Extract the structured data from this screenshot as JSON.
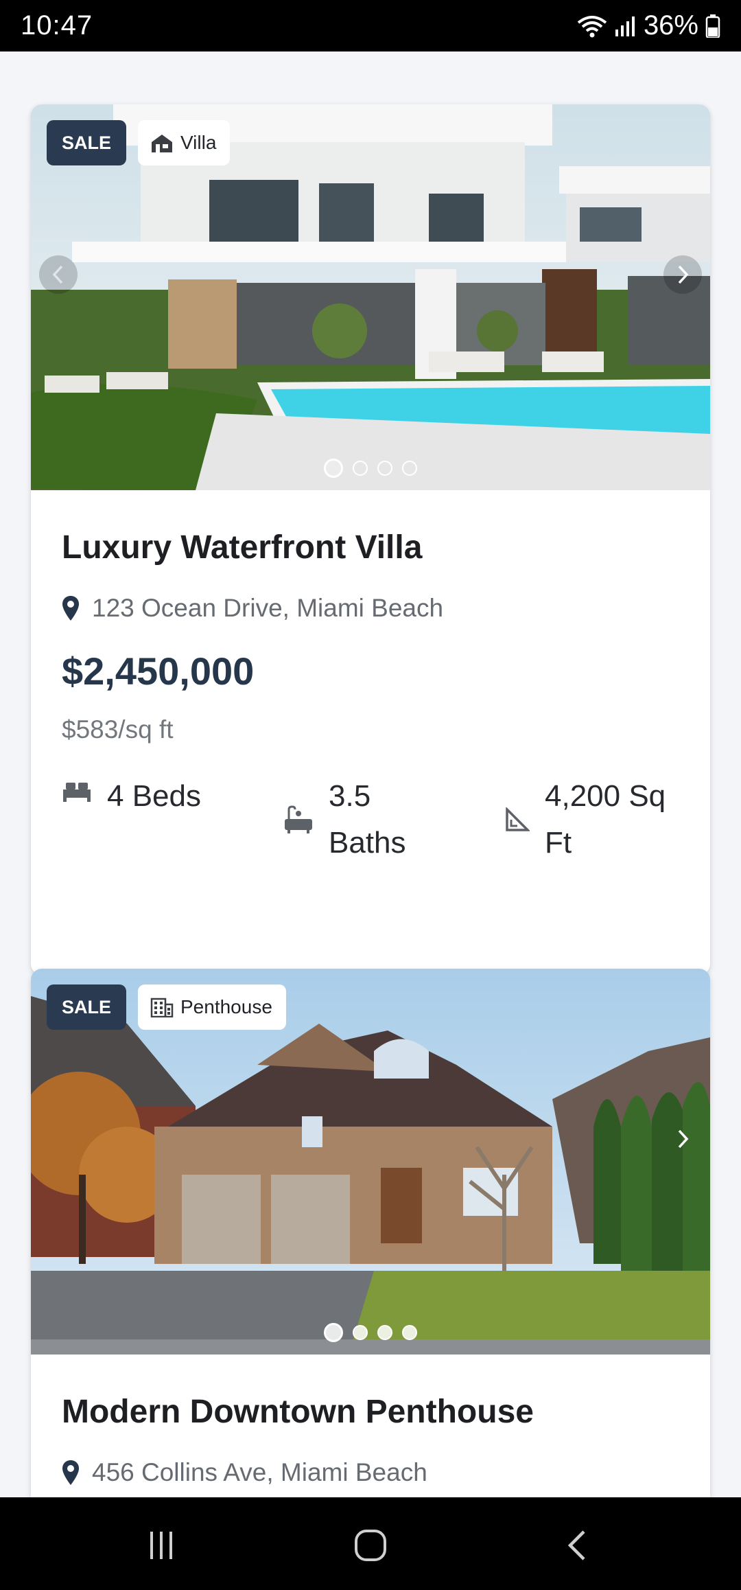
{
  "status_bar": {
    "time": "10:47",
    "battery": "36%"
  },
  "listings": [
    {
      "badge": "SALE",
      "type": "Villa",
      "type_icon": "villa-icon",
      "title": "Luxury Waterfront Villa",
      "address": "123 Ocean Drive, Miami Beach",
      "price": "$2,450,000",
      "price_per_sqft": "$583/sq ft",
      "beds": "4 Beds",
      "baths_line1": "3.5",
      "baths_line2": "Baths",
      "area_line1": "4,200 Sq",
      "area_line2": "Ft",
      "image_count": 4,
      "active_image": 1
    },
    {
      "badge": "SALE",
      "type": "Penthouse",
      "type_icon": "building-icon",
      "title": "Modern Downtown Penthouse",
      "address": "456 Collins Ave, Miami Beach",
      "image_count": 4,
      "active_image": 1
    }
  ],
  "colors": {
    "accent": "#26364b",
    "badge_bg": "#2a3a50"
  }
}
